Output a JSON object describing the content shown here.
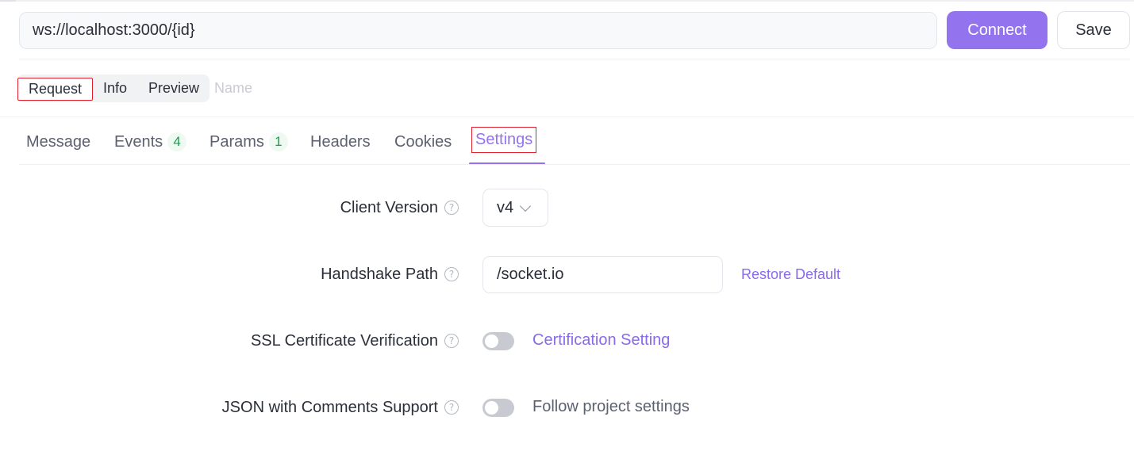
{
  "url_bar": {
    "url": "ws://localhost:3000/{id}",
    "connect_label": "Connect",
    "save_label": "Save"
  },
  "mode": {
    "options": [
      "Request",
      "Info",
      "Preview"
    ],
    "selected": "Request",
    "name_placeholder": "Name"
  },
  "tabs": [
    {
      "label": "Message"
    },
    {
      "label": "Events",
      "badge": "4"
    },
    {
      "label": "Params",
      "badge": "1"
    },
    {
      "label": "Headers"
    },
    {
      "label": "Cookies"
    },
    {
      "label": "Settings",
      "active": true
    }
  ],
  "settings": {
    "client_version": {
      "label": "Client Version",
      "value": "v4"
    },
    "handshake_path": {
      "label": "Handshake Path",
      "value": "/socket.io",
      "restore_label": "Restore Default"
    },
    "ssl": {
      "label": "SSL Certificate Verification",
      "enabled": false,
      "link_label": "Certification Setting"
    },
    "json_comments": {
      "label": "JSON with Comments Support",
      "enabled": false,
      "note": "Follow project settings"
    }
  },
  "icons": {
    "help": "help-circle-icon",
    "dropdown": "chevron-down-icon"
  },
  "colors": {
    "accent": "#9373ee",
    "badge_green": "#1e9e4f",
    "highlight_box": "#e0202c"
  }
}
